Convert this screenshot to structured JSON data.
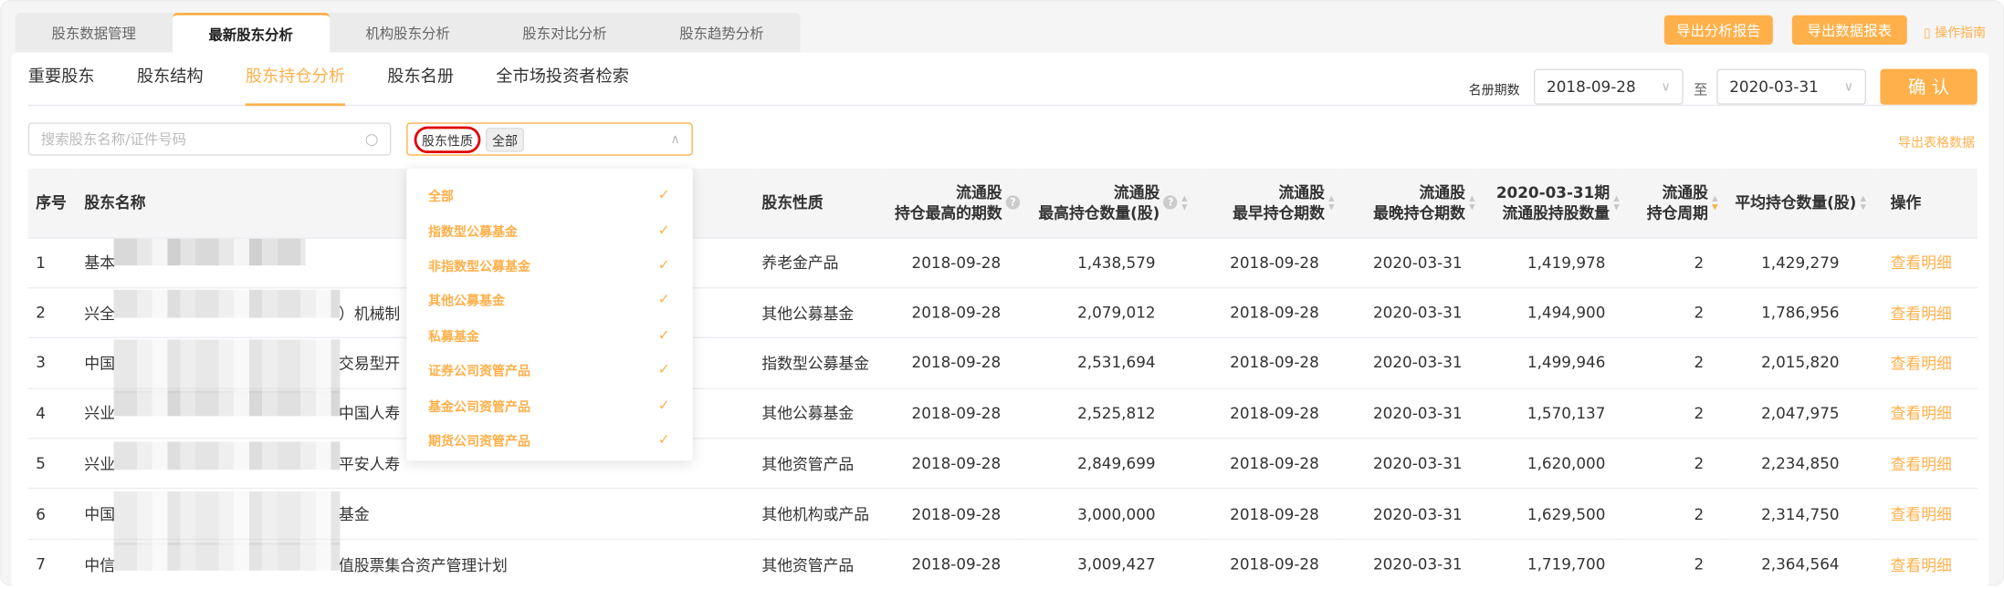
{
  "top_tabs": [
    "股东数据管理",
    "最新股东分析",
    "机构股东分析",
    "股东对比分析",
    "股东趋势分析"
  ],
  "active_top_tab": 1,
  "header_buttons": {
    "export_report": "导出分析报告",
    "export_data": "导出数据报表",
    "guide": "操作指南"
  },
  "sub_tabs": [
    "重要股东",
    "股东结构",
    "股东持仓分析",
    "股东名册",
    "全市场投资者检索"
  ],
  "active_sub_tab": 2,
  "period": {
    "label": "名册期数",
    "from": "2018-09-28",
    "to_label": "至",
    "to": "2020-03-31",
    "confirm": "确 认"
  },
  "search": {
    "placeholder": "搜索股东名称/证件号码"
  },
  "filter": {
    "label": "股东性质",
    "selected_tag": "全部"
  },
  "export_table": "导出表格数据",
  "dropdown_options": [
    "全部",
    "指数型公募基金",
    "非指数型公募基金",
    "其他公募基金",
    "私募基金",
    "证券公司资管产品",
    "基金公司资管产品",
    "期货公司资管产品"
  ],
  "table": {
    "headers": {
      "no": "序号",
      "name": "股东名称",
      "type": "股东性质",
      "c4a": "流通股",
      "c4b": "持仓最高的期数",
      "c5a": "流通股",
      "c5b": "最高持仓数量(股)",
      "c6a": "流通股",
      "c6b": "最早持仓期数",
      "c7a": "流通股",
      "c7b": "最晚持仓期数",
      "c8a": "2020-03-31期",
      "c8b": "流通股持股数量",
      "c9a": "流通股",
      "c9b": "持仓周期",
      "c10": "平均持仓数量(股)",
      "op": "操作"
    },
    "rows": [
      {
        "no": "1",
        "name_start": "基本",
        "name_end": "",
        "type": "养老金产品",
        "peak": "2018-09-28",
        "max": "1,438,579",
        "first": "2018-09-28",
        "last": "2020-03-31",
        "cur": "1,419,978",
        "cycle": "2",
        "avg": "1,429,279",
        "op": "查看明细"
      },
      {
        "no": "2",
        "name_start": "兴全",
        "name_end": "）机械制",
        "type": "其他公募基金",
        "peak": "2018-09-28",
        "max": "2,079,012",
        "first": "2018-09-28",
        "last": "2020-03-31",
        "cur": "1,494,900",
        "cycle": "2",
        "avg": "1,786,956",
        "op": "查看明细"
      },
      {
        "no": "3",
        "name_start": "中国",
        "name_end": "交易型开",
        "type": "指数型公募基金",
        "peak": "2018-09-28",
        "max": "2,531,694",
        "first": "2018-09-28",
        "last": "2020-03-31",
        "cur": "1,499,946",
        "cycle": "2",
        "avg": "2,015,820",
        "op": "查看明细"
      },
      {
        "no": "4",
        "name_start": "兴业",
        "name_end": "中国人寿",
        "type": "其他公募基金",
        "peak": "2018-09-28",
        "max": "2,525,812",
        "first": "2018-09-28",
        "last": "2020-03-31",
        "cur": "1,570,137",
        "cycle": "2",
        "avg": "2,047,975",
        "op": "查看明细"
      },
      {
        "no": "5",
        "name_start": "兴业",
        "name_end": "平安人寿",
        "type": "其他资管产品",
        "peak": "2018-09-28",
        "max": "2,849,699",
        "first": "2018-09-28",
        "last": "2020-03-31",
        "cur": "1,620,000",
        "cycle": "2",
        "avg": "2,234,850",
        "op": "查看明细"
      },
      {
        "no": "6",
        "name_start": "中国",
        "name_end": "基金",
        "type": "其他机构或产品",
        "peak": "2018-09-28",
        "max": "3,000,000",
        "first": "2018-09-28",
        "last": "2020-03-31",
        "cur": "1,629,500",
        "cycle": "2",
        "avg": "2,314,750",
        "op": "查看明细"
      },
      {
        "no": "7",
        "name_start": "中信",
        "name_end": "值股票集合资产管理计划",
        "type": "其他资管产品",
        "peak": "2018-09-28",
        "max": "3,009,427",
        "first": "2018-09-28",
        "last": "2020-03-31",
        "cur": "1,719,700",
        "cycle": "2",
        "avg": "2,364,564",
        "op": "查看明细"
      }
    ]
  },
  "colors": {
    "accent": "#ffb04a",
    "highlight_circle": "#e00000"
  }
}
